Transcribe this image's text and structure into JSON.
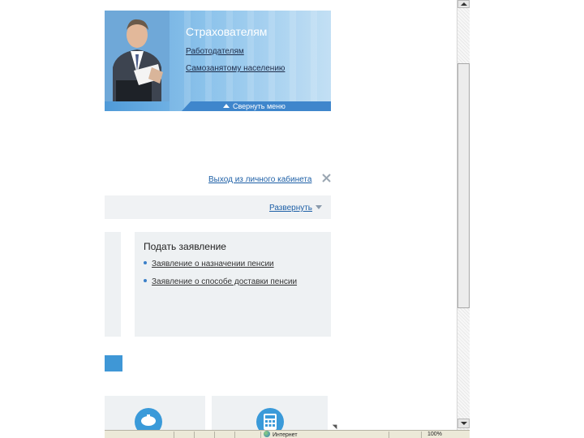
{
  "banner": {
    "title": "Страхователям",
    "links": [
      "Работодателям",
      "Самозанятому населению"
    ],
    "collapse_label": "Свернуть меню"
  },
  "cabinet": {
    "logout_label": "Выход из личного кабинета",
    "expand_label": "Развернуть"
  },
  "apply_panel": {
    "title": "Подать заявление",
    "links": [
      "Заявление о назначении пенсии",
      "Заявление о способе доставки пенсии"
    ]
  },
  "statusbar": {
    "zone": "Интернет",
    "zoom": "100%"
  },
  "colors": {
    "accent_blue": "#3f97d6",
    "link_blue": "#1d5fa6",
    "panel_gray": "#eef1f3"
  },
  "icons": [
    "person-photo",
    "collapse-arrow-icon",
    "close-icon",
    "expand-arrow-icon",
    "piggybank-icon",
    "calculator-icon",
    "globe-icon"
  ]
}
